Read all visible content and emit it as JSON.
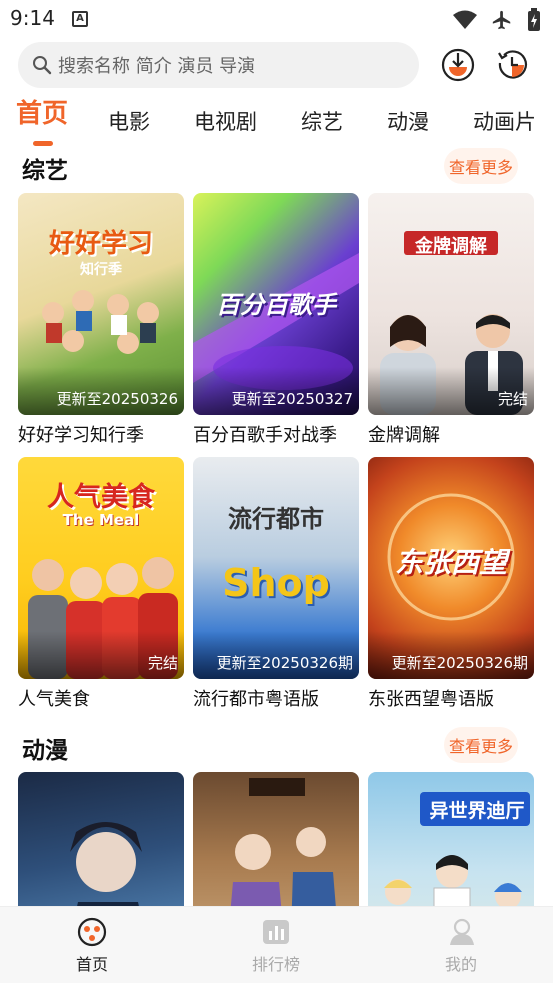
{
  "status_bar": {
    "time": "9:14",
    "notification_icon": "a-icon"
  },
  "search": {
    "placeholder": "搜索名称 简介 演员 导演"
  },
  "header_icons": [
    "download-icon",
    "history-icon"
  ],
  "tabs": [
    {
      "label": "首页",
      "active": true
    },
    {
      "label": "电影"
    },
    {
      "label": "电视剧"
    },
    {
      "label": "综艺"
    },
    {
      "label": "动漫"
    },
    {
      "label": "动画片"
    }
  ],
  "sections": [
    {
      "title": "综艺",
      "more_label": "查看更多",
      "items": [
        {
          "title": "好好学习知行季",
          "badge": "更新至20250326",
          "poster_text": "好好学习",
          "poster_sub": "知行季"
        },
        {
          "title": "百分百歌手对战季",
          "badge": "更新至20250327",
          "poster_text": "百分百歌手"
        },
        {
          "title": "金牌调解",
          "badge": "完结",
          "poster_text": "金牌调解"
        },
        {
          "title": "人气美食",
          "badge": "完结",
          "poster_text": "人气美食",
          "poster_sub": "The Meal"
        },
        {
          "title": "流行都市粤语版",
          "badge": "更新至20250326期",
          "poster_text": "流行都市",
          "poster_sub": "Shop"
        },
        {
          "title": "东张西望粤语版",
          "badge": "更新至20250326期",
          "poster_text": "东张西望"
        }
      ]
    },
    {
      "title": "动漫",
      "more_label": "查看更多",
      "items": [
        {
          "title": "",
          "badge": ""
        },
        {
          "title": "",
          "badge": ""
        },
        {
          "title": "",
          "badge": "",
          "poster_text": "异世界迪厅"
        }
      ]
    }
  ],
  "bottom_nav": [
    {
      "label": "首页",
      "icon": "film-reel-icon",
      "active": true
    },
    {
      "label": "排行榜",
      "icon": "chart-icon"
    },
    {
      "label": "我的",
      "icon": "user-icon"
    }
  ],
  "colors": {
    "accent": "#f0652a",
    "more_bg": "#fff3ec"
  }
}
